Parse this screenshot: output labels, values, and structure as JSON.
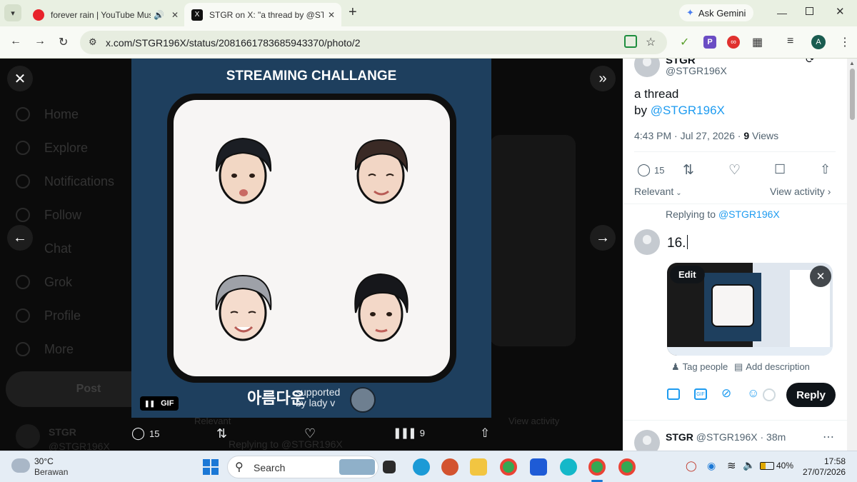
{
  "browser": {
    "tabs": [
      {
        "title": "forever rain | YouTube Musi",
        "close": "✕"
      },
      {
        "title": "STGR on X: \"a thread by @STGR",
        "close": "✕"
      }
    ],
    "new_tab": "+",
    "ask_gemini": "Ask Gemini",
    "url": "x.com/STGR196X/status/2081661783685943370/photo/2",
    "profile_initial": "A"
  },
  "sidebar_ghost": [
    "Home",
    "Explore",
    "Notifications",
    "Follow",
    "Chat",
    "Grok",
    "Profile",
    "More"
  ],
  "post_button": "Post",
  "ghost_bottom": {
    "name": "STGR",
    "handle": "@STGR196X",
    "relevant": "Relevant",
    "view_activity": "View activity",
    "replying": "Replying to @STGR196X"
  },
  "media": {
    "title": "STREAMING CHALLANGE",
    "sponsor_line1": "supported",
    "sponsor_line2": "by lady v",
    "logo_text": "아름다운",
    "gif_label": "GIF",
    "replies": "15",
    "views": "9"
  },
  "tweet": {
    "name": "STGR",
    "handle": "@STGR196X",
    "text_line1": "a thread",
    "text_by": "by ",
    "text_mention": "@STGR196X",
    "time": "4:43 PM · Jul 27, 2026 · ",
    "views_count": "9",
    "views_label": " Views",
    "reply_count": "15",
    "relevant": "Relevant",
    "view_activity": "View activity"
  },
  "compose": {
    "replying_prefix": "Replying to ",
    "replying_to": "@STGR196X",
    "text": "16.",
    "edit": "Edit",
    "tag_people": "Tag people",
    "add_description": "Add description",
    "reply_button": "Reply"
  },
  "next_reply": {
    "name": "STGR",
    "handle": "@STGR196X",
    "time": "· 38m"
  },
  "taskbar": {
    "temp": "30°C",
    "weather": "Berawan",
    "search_placeholder": "Search",
    "battery": "40%",
    "time": "17:58",
    "date": "27/07/2026"
  }
}
